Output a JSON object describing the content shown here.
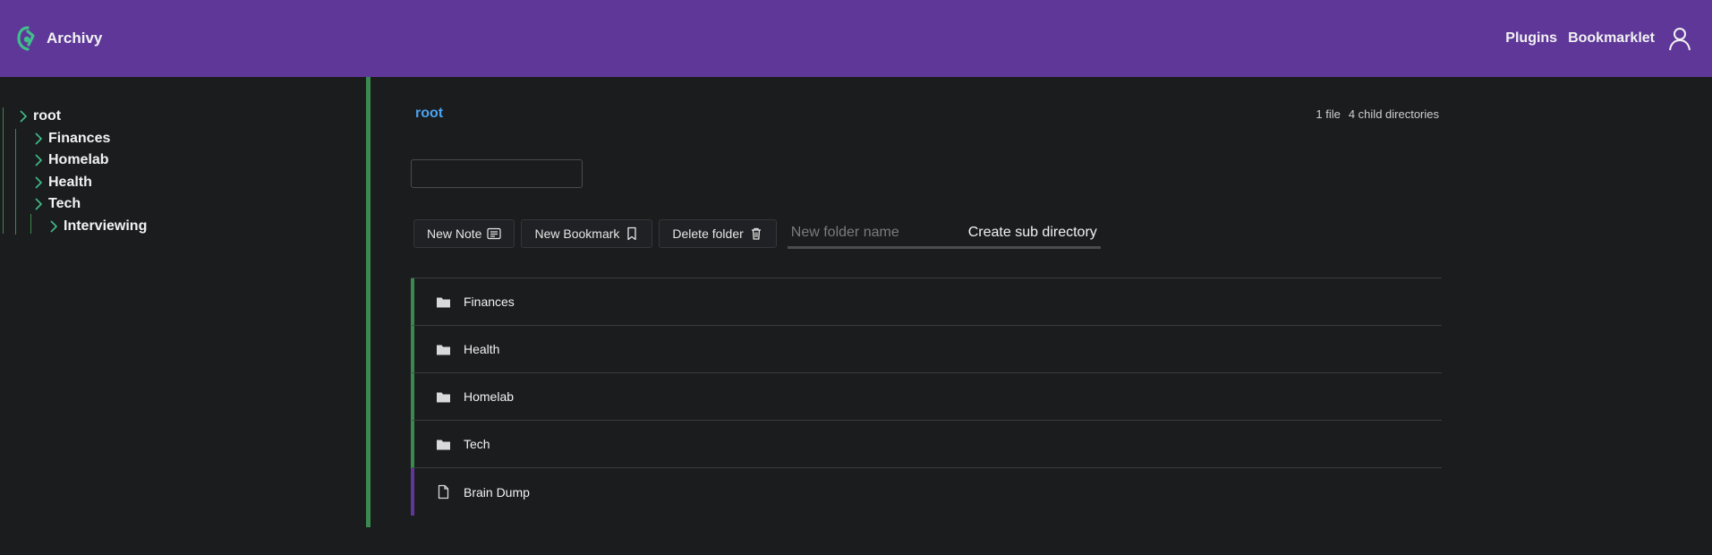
{
  "header": {
    "brand": "Archivy",
    "nav": [
      "Plugins",
      "Bookmarklet"
    ],
    "colors": {
      "bar": "#5e3799",
      "logo": "#3fbf8a"
    },
    "icons": {
      "logo": "archivy-logo-icon",
      "user": "user-icon"
    }
  },
  "sidebar": {
    "tree": [
      {
        "label": "root",
        "depth": 0
      },
      {
        "label": "Finances",
        "depth": 1
      },
      {
        "label": "Homelab",
        "depth": 1
      },
      {
        "label": "Health",
        "depth": 1
      },
      {
        "label": "Tech",
        "depth": 1
      },
      {
        "label": "Interviewing",
        "depth": 2
      }
    ],
    "accent": "#3a8a4f"
  },
  "main": {
    "breadcrumb": "root",
    "counts": {
      "files": "1 file",
      "dirs": "4 child directories"
    },
    "search": {
      "placeholder": ""
    },
    "actions": {
      "new_note": "New Note",
      "new_bookmark": "New Bookmark",
      "delete_folder": "Delete folder",
      "folder_placeholder": "New folder name",
      "create_subdir": "Create sub directory"
    },
    "entries": [
      {
        "name": "Finances",
        "kind": "folder",
        "icon": "folder-icon"
      },
      {
        "name": "Health",
        "kind": "folder",
        "icon": "folder-icon"
      },
      {
        "name": "Homelab",
        "kind": "folder",
        "icon": "folder-icon"
      },
      {
        "name": "Tech",
        "kind": "folder",
        "icon": "folder-icon"
      },
      {
        "name": "Brain Dump",
        "kind": "file",
        "icon": "file-icon"
      }
    ]
  }
}
